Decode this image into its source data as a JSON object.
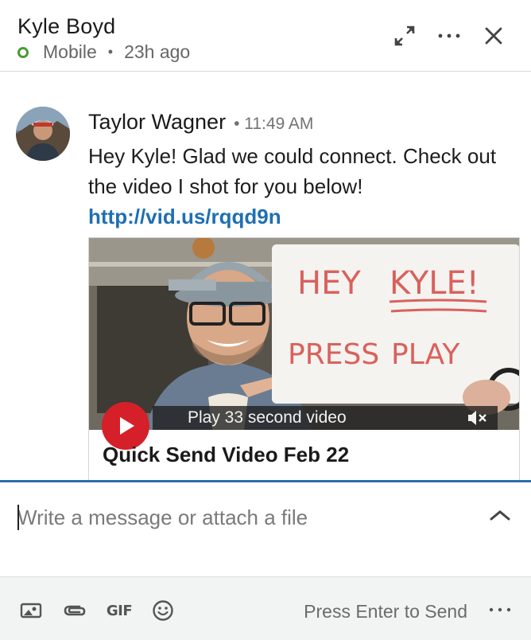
{
  "header": {
    "contact_name": "Kyle Boyd",
    "status_device": "Mobile",
    "status_separator": "•",
    "status_time": "23h ago",
    "status_color": "#4a9a34",
    "icons": [
      "expand-icon",
      "more-icon",
      "close-icon"
    ]
  },
  "message": {
    "sender_name": "Taylor Wagner",
    "time": "• 11:49 AM",
    "text": "Hey Kyle! Glad we could connect. Check out the video I shot for you below! ",
    "link": "http://vid.us/rqqd9n",
    "link_color": "#1f6fb2"
  },
  "video": {
    "bar_label": "Play 33 second video",
    "title": "Quick Send Video Feb 22",
    "sign_line1": "HEY KYLE!",
    "sign_line2": "PRESS PLAY",
    "play_color": "#d52029"
  },
  "compose": {
    "placeholder": "Write a message or attach a file",
    "accent_color": "#2d6fa6"
  },
  "footer": {
    "icons": [
      "image-icon",
      "attachment-icon",
      "gif-icon",
      "emoji-icon"
    ],
    "gif_label": "GIF",
    "send_hint": "Press Enter to Send"
  }
}
